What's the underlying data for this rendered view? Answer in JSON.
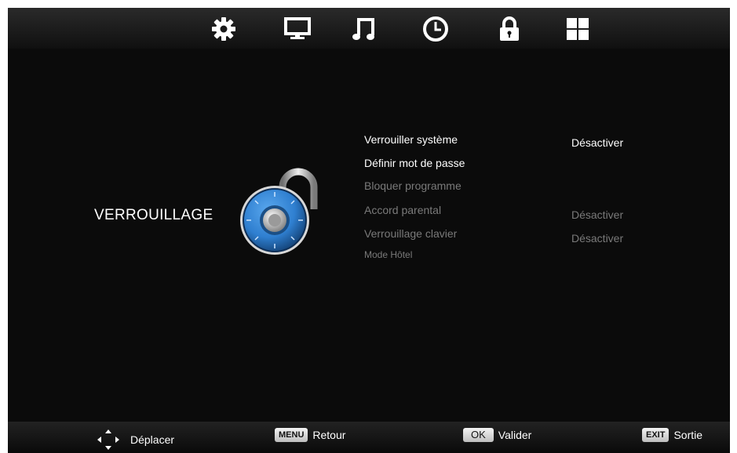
{
  "tabs": [
    {
      "name": "settings",
      "icon": "gear-icon"
    },
    {
      "name": "picture",
      "icon": "monitor-icon"
    },
    {
      "name": "sound",
      "icon": "music-note-icon"
    },
    {
      "name": "time",
      "icon": "clock-icon"
    },
    {
      "name": "lock",
      "icon": "padlock-icon",
      "active": true
    },
    {
      "name": "apps",
      "icon": "grid-icon"
    }
  ],
  "section": {
    "title": "VERROUILLAGE",
    "image": "combination-padlock-icon"
  },
  "menu": {
    "items": [
      {
        "label": "Verrouiller système",
        "value": "Désactiver",
        "enabled": true
      },
      {
        "label": "Définir mot de passe",
        "value": "",
        "enabled": true
      },
      {
        "label": "Bloquer programme",
        "value": "",
        "enabled": false
      },
      {
        "label": "Accord parental",
        "value": "Désactiver",
        "enabled": false
      },
      {
        "label": "Verrouillage clavier",
        "value": "Désactiver",
        "enabled": false
      },
      {
        "label": "Mode Hôtel",
        "value": "",
        "enabled": false
      }
    ]
  },
  "footer": {
    "move_label": "Déplacer",
    "menu_key": "MENU",
    "back_label": "Retour",
    "ok_key": "OK",
    "confirm_label": "Valider",
    "exit_key": "EXIT",
    "exit_label": "Sortie"
  },
  "colors": {
    "background": "#0b0b0b",
    "text_active": "#ffffff",
    "text_disabled": "#7a7a7a",
    "lock_blue": "#2f7fd0"
  }
}
